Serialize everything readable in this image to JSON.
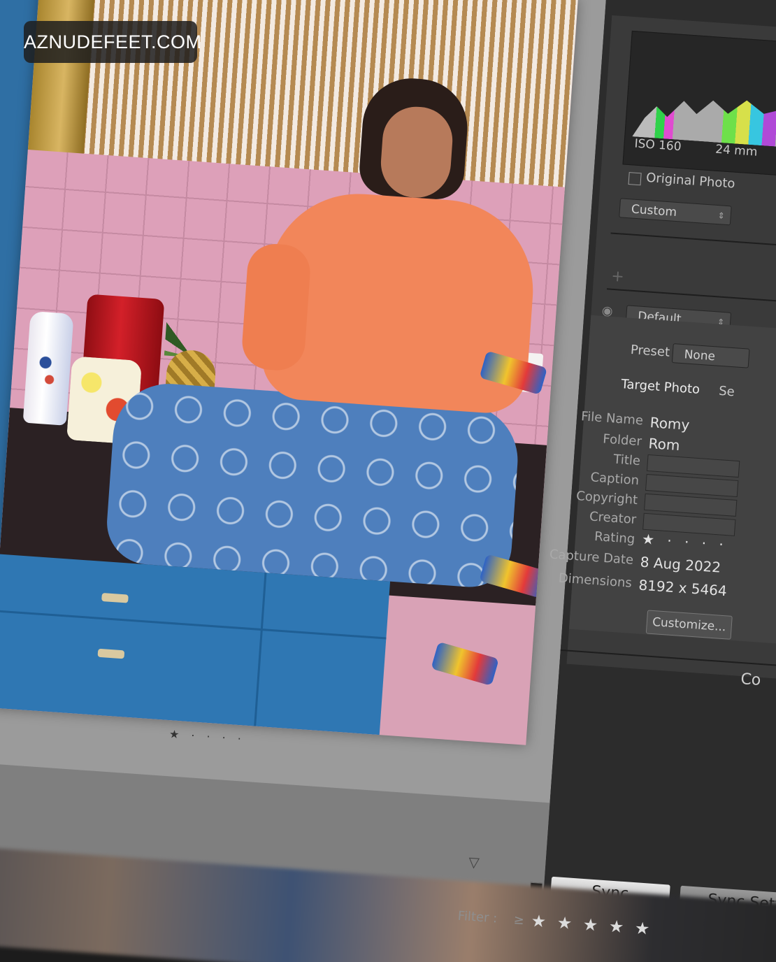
{
  "watermark": "AZNUDEFEET.COM",
  "loupe": {
    "rating_display": "★ · · · ·",
    "collapse_arrow": "▽"
  },
  "histogram": {
    "iso": "ISO 160",
    "focal": "24 mm",
    "original_photo_label": "Original Photo"
  },
  "develop": {
    "profile_select": "Custom",
    "color_select": "Default",
    "preset_label": "Preset",
    "preset_value": "None"
  },
  "metadata": {
    "tab_target": "Target Photo",
    "tab_second": "Se",
    "fields": [
      {
        "label": "File Name",
        "value": "Romy"
      },
      {
        "label": "Folder",
        "value": "Rom"
      },
      {
        "label": "Title",
        "value": ""
      },
      {
        "label": "Caption",
        "value": ""
      },
      {
        "label": "Copyright",
        "value": ""
      },
      {
        "label": "Creator",
        "value": ""
      },
      {
        "label": "Rating",
        "value": "★ · · · ·"
      },
      {
        "label": "Capture Date",
        "value": "8 Aug 2022"
      },
      {
        "label": "Dimensions",
        "value": "8192 x 5464"
      }
    ],
    "customize_button": "Customize...",
    "next_section_fragment": "Co"
  },
  "footer": {
    "sync_button": "Sync",
    "sync_settings_button": "Sync Setti",
    "filter_label": "Filter :",
    "filter_operator": "≥",
    "filter_stars": "★ ★ ★ ★ ★"
  },
  "colors": {
    "panel_bg": "#2c2c2c",
    "loupe_bg": "#9b9b9b",
    "accent_orange": "#f2865a",
    "cabinet_blue": "#2f77b3"
  }
}
